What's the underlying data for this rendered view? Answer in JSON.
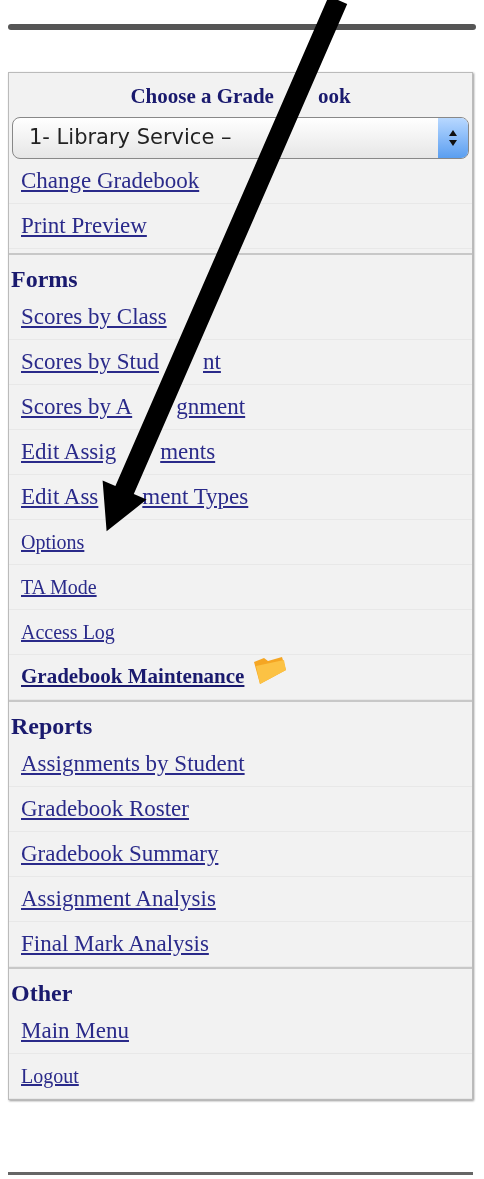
{
  "gradebook_chooser": {
    "title_parts": [
      "Choose a Grade",
      "ook"
    ],
    "select_value": "1- Library Service –",
    "links": [
      {
        "parts": [
          "Change Gradebook"
        ],
        "kind": "link"
      },
      {
        "parts": [
          "Print Preview"
        ],
        "kind": "link"
      }
    ]
  },
  "sections": [
    {
      "title": "Forms",
      "links": [
        {
          "parts": [
            "Scores by Class"
          ],
          "kind": "link"
        },
        {
          "parts": [
            "Scores by Stud",
            "nt"
          ],
          "kind": "link"
        },
        {
          "parts": [
            "Scores by A",
            "gnment"
          ],
          "kind": "link"
        },
        {
          "parts": [
            "Edit Assig",
            "ments"
          ],
          "kind": "link"
        },
        {
          "parts": [
            "Edit Ass",
            "ment Types"
          ],
          "kind": "link"
        },
        {
          "parts": [
            "Options"
          ],
          "kind": "small"
        },
        {
          "parts": [
            "TA Mode"
          ],
          "kind": "small"
        },
        {
          "parts": [
            "Access Log"
          ],
          "kind": "small"
        },
        {
          "parts": [
            "Gradebook Maintenance"
          ],
          "kind": "bold"
        }
      ]
    },
    {
      "title": "Reports",
      "links": [
        {
          "parts": [
            "Assignments by Student"
          ],
          "kind": "link"
        },
        {
          "parts": [
            "Gradebook Roster"
          ],
          "kind": "link"
        },
        {
          "parts": [
            "Gradebook Summary"
          ],
          "kind": "link"
        },
        {
          "parts": [
            "Assignment Analysis"
          ],
          "kind": "link"
        },
        {
          "parts": [
            "Final Mark Analysis"
          ],
          "kind": "link"
        }
      ]
    },
    {
      "title": "Other",
      "links": [
        {
          "parts": [
            "Main Menu"
          ],
          "kind": "link"
        },
        {
          "parts": [
            "Logout"
          ],
          "kind": "small"
        }
      ]
    }
  ]
}
